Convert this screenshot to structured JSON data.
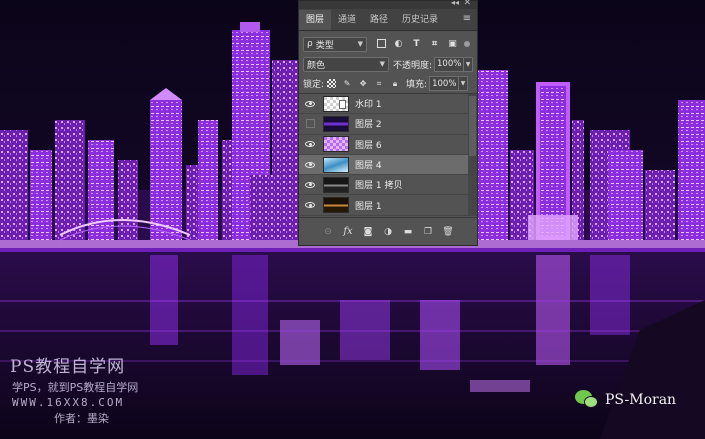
{
  "panel": {
    "tabs": [
      {
        "label": "图层",
        "active": true
      },
      {
        "label": "通道",
        "active": false
      },
      {
        "label": "路径",
        "active": false
      },
      {
        "label": "历史记录",
        "active": false
      }
    ],
    "filter": {
      "search_glyph": "ρ",
      "value": "类型"
    },
    "blend_mode": "颜色",
    "opacity": {
      "label": "不透明度:",
      "value": "100%"
    },
    "lock": {
      "label": "锁定:"
    },
    "fill": {
      "label": "填充:",
      "value": "100%"
    },
    "layers": [
      {
        "name": "水印 1",
        "visible": true,
        "selected": false
      },
      {
        "name": "图层 2",
        "visible": false,
        "selected": false
      },
      {
        "name": "图层 6",
        "visible": true,
        "selected": false
      },
      {
        "name": "图层 4",
        "visible": true,
        "selected": true
      },
      {
        "name": "图层 1 拷贝",
        "visible": true,
        "selected": false
      },
      {
        "name": "图层 1",
        "visible": true,
        "selected": false
      }
    ],
    "bottom_fx": "fx"
  },
  "watermark": {
    "title": "PS教程自学网",
    "line2": "学PS，就到PS教程自学网",
    "url": "WWW.16XX8.COM",
    "author": "作者：墨染",
    "handle": "PS-Moran"
  },
  "colors": {
    "city_purple": "#b14cff",
    "sky": "#0a0418",
    "panel_bg": "#535353",
    "selected_layer": "#6c6c6c"
  }
}
